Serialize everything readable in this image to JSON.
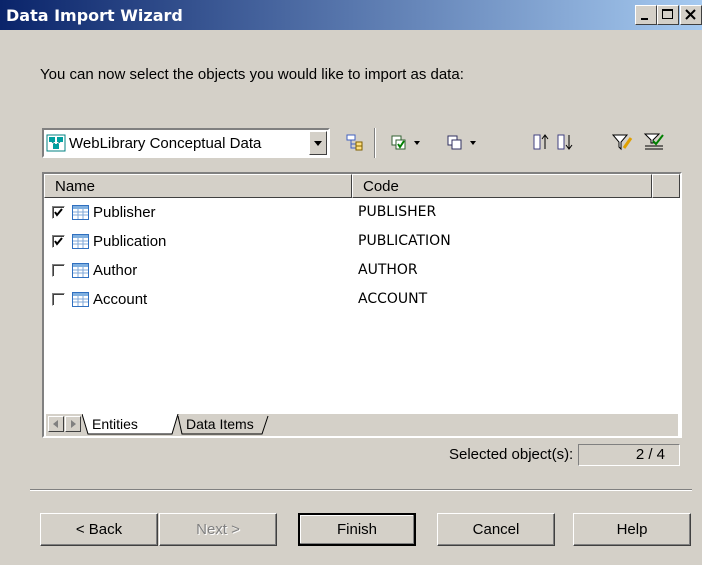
{
  "window": {
    "title": "Data Import Wizard"
  },
  "intro_text": "You can now select the objects you would like to import as data:",
  "toolbar": {
    "model_select_value": "WebLibrary Conceptual Data",
    "icons": [
      "hierarchy-icon",
      "select-all-icon",
      "deselect-icon",
      "move-up-icon",
      "move-down-icon",
      "filter-icon",
      "filter-apply-icon"
    ]
  },
  "list": {
    "columns": [
      "Name",
      "Code"
    ],
    "rows": [
      {
        "checked": true,
        "name": "Publisher",
        "code": "PUBLISHER"
      },
      {
        "checked": true,
        "name": "Publication",
        "code": "PUBLICATION"
      },
      {
        "checked": false,
        "name": "Author",
        "code": "AUTHOR"
      },
      {
        "checked": false,
        "name": "Account",
        "code": "ACCOUNT"
      }
    ]
  },
  "tabs": [
    {
      "label": "Entities",
      "active": true
    },
    {
      "label": "Data Items",
      "active": false
    }
  ],
  "selected": {
    "label": "Selected object(s):",
    "value": "2 / 4"
  },
  "buttons": {
    "back": "< Back",
    "next": "Next >",
    "finish": "Finish",
    "cancel": "Cancel",
    "help": "Help"
  },
  "colors": {
    "titlebar_start": "#0a246a",
    "titlebar_end": "#a6caf0",
    "face": "#d4d0c8"
  }
}
